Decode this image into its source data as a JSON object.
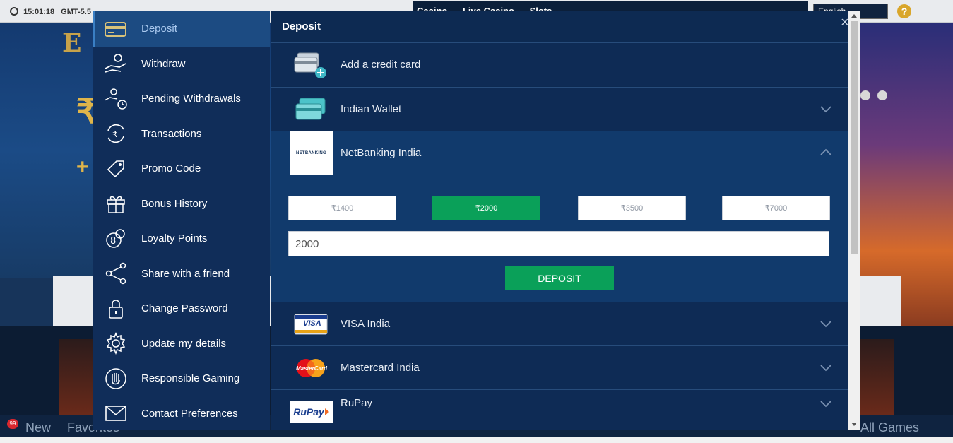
{
  "background": {
    "clock": "15:01:18",
    "timezone": "GMT-5.5",
    "nav": [
      "Casino",
      "Live Casino",
      "Slots"
    ],
    "language": "English",
    "bottom": {
      "new": "New",
      "favorites": "Favorites",
      "all_games": "All Games",
      "badge": "99"
    }
  },
  "sidebar": {
    "items": [
      {
        "label": "Deposit",
        "icon": "card-icon"
      },
      {
        "label": "Withdraw",
        "icon": "hand-coins-icon"
      },
      {
        "label": "Pending Withdrawals",
        "icon": "hand-clock-icon"
      },
      {
        "label": "Transactions",
        "icon": "rupee-cycle-icon"
      },
      {
        "label": "Promo Code",
        "icon": "tag-icon"
      },
      {
        "label": "Bonus History",
        "icon": "gift-icon"
      },
      {
        "label": "Loyalty Points",
        "icon": "coins-icon"
      },
      {
        "label": "Share with a friend",
        "icon": "share-icon"
      },
      {
        "label": "Change Password",
        "icon": "lock-icon"
      },
      {
        "label": "Update my details",
        "icon": "gear-icon"
      },
      {
        "label": "Responsible Gaming",
        "icon": "hand-stop-icon"
      },
      {
        "label": "Contact Preferences",
        "icon": "envelope-icon"
      }
    ]
  },
  "panel": {
    "title": "Deposit",
    "close": "×",
    "methods": [
      {
        "label": "Add a credit card"
      },
      {
        "label": "Indian Wallet"
      },
      {
        "label": "NetBanking India",
        "logo_text": "NETBANKING"
      },
      {
        "label": "VISA India",
        "logo_text": "VISA"
      },
      {
        "label": "Mastercard India",
        "logo_text": "MasterCard"
      },
      {
        "label": "RuPay",
        "logo_text": "RuPay"
      }
    ],
    "amounts": [
      "₹1400",
      "₹2000",
      "₹3500",
      "₹7000"
    ],
    "selected_amount": "₹2000",
    "amount_input_value": "2000",
    "deposit_button": "DEPOSIT"
  },
  "colors": {
    "accent_green": "#0aa059",
    "panel_bg": "#0d2a52",
    "sidebar_bg": "#102d59",
    "active_item": "#1c4b82"
  }
}
